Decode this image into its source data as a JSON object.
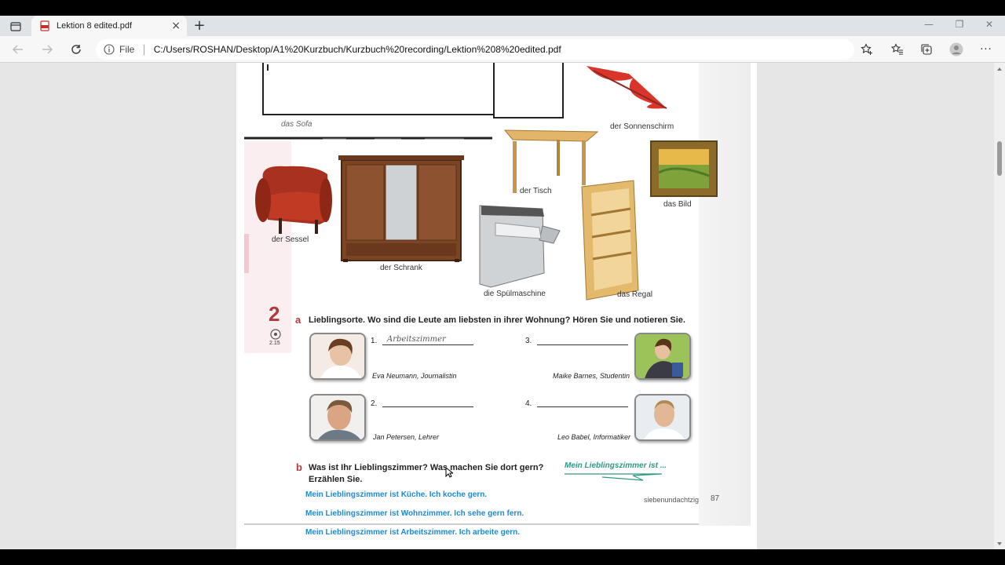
{
  "browser": {
    "tab": {
      "title": "Lektion 8 edited.pdf",
      "close": "×"
    },
    "new_tab": "+",
    "window_controls": {
      "minimize": "—",
      "restore": "❐",
      "close": "✕"
    },
    "address": {
      "scheme_label": "File",
      "separator": "|",
      "url": "C:/Users/ROSHAN/Desktop/A1%20Kurzbuch/Kurzbuch%20recording/Lektion%208%20edited.pdf"
    },
    "more_label": "···"
  },
  "pdf": {
    "furniture_labels": {
      "sofa": "das Sofa",
      "sonnenschirm": "der Sonnenschirm",
      "sessel": "der Sessel",
      "schrank": "der Schrank",
      "tisch": "der Tisch",
      "spuelmaschine": "die Spülmaschine",
      "regal": "das Regal",
      "bild": "das Bild"
    },
    "exercise": {
      "number": "2",
      "track": "2.15",
      "part_a_letter": "a",
      "part_a_text": "Lieblingsorte. Wo sind die Leute am liebsten in ihrer Wohnung? Hören Sie und notieren Sie.",
      "items": [
        {
          "num": "1.",
          "answer": "Arbeitszimmer",
          "caption": "Eva Neumann, Journalistin"
        },
        {
          "num": "2.",
          "answer": "",
          "caption": "Jan Petersen, Lehrer"
        },
        {
          "num": "3.",
          "answer": "",
          "caption": "Maike Barnes, Studentin"
        },
        {
          "num": "4.",
          "answer": "",
          "caption": "Leo Babel, Informatiker"
        }
      ],
      "part_b_letter": "b",
      "part_b_text_1": "Was ist Ihr Lieblingszimmer? Was machen Sie dort gern?",
      "part_b_text_2": "Erzählen Sie.",
      "speech_bubble": "Mein Lieblingszimmer ist ...",
      "answers": [
        "Mein Lieblingszimmer ist Küche. Ich koche gern.",
        "Mein Lieblingszimmer ist Wohnzimmer. Ich sehe gern fern.",
        "Mein Lieblingszimmer ist Arbeitszimmer. Ich arbeite gern."
      ]
    },
    "footer": {
      "page_word": "siebenundachtzig",
      "page_number": "87"
    }
  }
}
